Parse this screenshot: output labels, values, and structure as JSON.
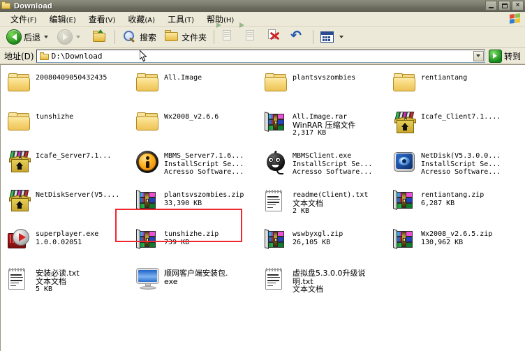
{
  "window": {
    "title": "Download",
    "icon": "folder-icon",
    "buttons": {
      "minimize": "_",
      "maximize": "□",
      "close": "×"
    }
  },
  "menubar": {
    "items": [
      {
        "label": "文件",
        "accel": "(F)",
        "name": "file"
      },
      {
        "label": "编辑",
        "accel": "(E)",
        "name": "edit"
      },
      {
        "label": "查看",
        "accel": "(V)",
        "name": "view"
      },
      {
        "label": "收藏",
        "accel": "(A)",
        "name": "favorites"
      },
      {
        "label": "工具",
        "accel": "(T)",
        "name": "tools"
      },
      {
        "label": "帮助",
        "accel": "(H)",
        "name": "help"
      }
    ],
    "brand_icon": "windows-flag-icon"
  },
  "toolbar": {
    "back_label": "后退",
    "forward_label": "",
    "up_label": "",
    "search_label": "搜索",
    "folders_label": "文件夹",
    "move_to_label": "",
    "copy_to_label": "",
    "delete_label": "",
    "undo_label": "",
    "views_label": ""
  },
  "address": {
    "label": "地址(D)",
    "value": "D:\\Download",
    "placeholder": "",
    "go_label": "转到",
    "icon": "folder-icon"
  },
  "selection": {
    "highlight_color": "#f0282d",
    "highlighted_item": "MBMS_Server7.1.6..."
  },
  "files": [
    {
      "icon": "folder-icon",
      "type": "folder",
      "name": "20080409050432435",
      "line2": "",
      "line3": "",
      "cn": false
    },
    {
      "icon": "folder-icon",
      "type": "folder",
      "name": "All.Image",
      "line2": "",
      "line3": "",
      "cn": false
    },
    {
      "icon": "folder-icon",
      "type": "folder",
      "name": "plantsvszombies",
      "line2": "",
      "line3": "",
      "cn": false
    },
    {
      "icon": "folder-icon",
      "type": "folder",
      "name": "rentiantang",
      "line2": "",
      "line3": "",
      "cn": false
    },
    {
      "icon": "folder-icon",
      "type": "folder",
      "name": "tunshizhe",
      "line2": "",
      "line3": "",
      "cn": false
    },
    {
      "icon": "folder-icon",
      "type": "folder",
      "name": "Wx2008_v2.6.6",
      "line2": "",
      "line3": "",
      "cn": false
    },
    {
      "icon": "winrar-icon",
      "type": "rar",
      "name": "All.Image.rar",
      "line2": "WinRAR 压缩文件",
      "line3": "2,317 KB",
      "cn": false,
      "line2_cn": true
    },
    {
      "icon": "package-icon",
      "type": "package",
      "name": "Icafe_Client7.1....",
      "line2": "",
      "line3": "",
      "cn": false
    },
    {
      "icon": "package-icon",
      "type": "package",
      "name": "Icafe_Server7.1...",
      "line2": "",
      "line3": "",
      "cn": false
    },
    {
      "icon": "installshield-info-icon",
      "type": "setup",
      "name": "MBMS_Server7.1.6...",
      "line2": "InstallScript Se...",
      "line3": "Acresso Software...",
      "cn": false,
      "highlighted": true
    },
    {
      "icon": "blob-face-icon",
      "type": "setup",
      "name": "MBMSClient.exe",
      "line2": "InstallScript Se...",
      "line3": "Acresso Software...",
      "cn": false
    },
    {
      "icon": "netdisk-icon",
      "type": "setup",
      "name": "NetDisk(V5.3.0.0...",
      "line2": "InstallScript Se...",
      "line3": "Acresso Software...",
      "cn": false
    },
    {
      "icon": "package-icon",
      "type": "package",
      "name": "NetDiskServer(V5....",
      "line2": "",
      "line3": "",
      "cn": false
    },
    {
      "icon": "winrar-icon",
      "type": "zip",
      "name": "plantsvszombies.zip",
      "line2": "33,390 KB",
      "line3": "",
      "cn": false
    },
    {
      "icon": "text-document-icon",
      "type": "txt",
      "name": "readme(Client).txt",
      "line2": "文本文档",
      "line3": "2 KB",
      "cn": false,
      "line2_cn": true
    },
    {
      "icon": "winrar-icon",
      "type": "zip",
      "name": "rentiantang.zip",
      "line2": "6,287 KB",
      "line3": "",
      "cn": false
    },
    {
      "icon": "media-player-icon",
      "type": "exe",
      "name": "superplayer.exe",
      "line2": "1.0.0.02051",
      "line3": "",
      "cn": false
    },
    {
      "icon": "winrar-icon",
      "type": "zip",
      "name": "tunshizhe.zip",
      "line2": "739 KB",
      "line3": "",
      "cn": false
    },
    {
      "icon": "winrar-icon",
      "type": "zip",
      "name": "wswbyxgl.zip",
      "line2": "26,105 KB",
      "line3": "",
      "cn": false
    },
    {
      "icon": "winrar-icon",
      "type": "zip",
      "name": "Wx2008_v2.6.5.zip",
      "line2": "130,962 KB",
      "line3": "",
      "cn": false
    },
    {
      "icon": "text-document-icon",
      "type": "txt",
      "name": "安装必读.txt",
      "line2": "文本文档",
      "line3": "5 KB",
      "cn": true,
      "line2_cn": true
    },
    {
      "icon": "monitor-icon",
      "type": "exe",
      "name": "顺网客户端安装包.",
      "line2": "exe",
      "line3": "",
      "cn": true
    },
    {
      "icon": "text-document-icon",
      "type": "txt",
      "name": "虚拟盘5.3.0.0升级说",
      "line2": "明.txt",
      "line3": "文本文档",
      "cn": true,
      "line2_cn": true,
      "line3_cn": true
    },
    {
      "icon": "",
      "type": "empty",
      "name": "",
      "line2": "",
      "line3": "",
      "cn": false
    }
  ]
}
